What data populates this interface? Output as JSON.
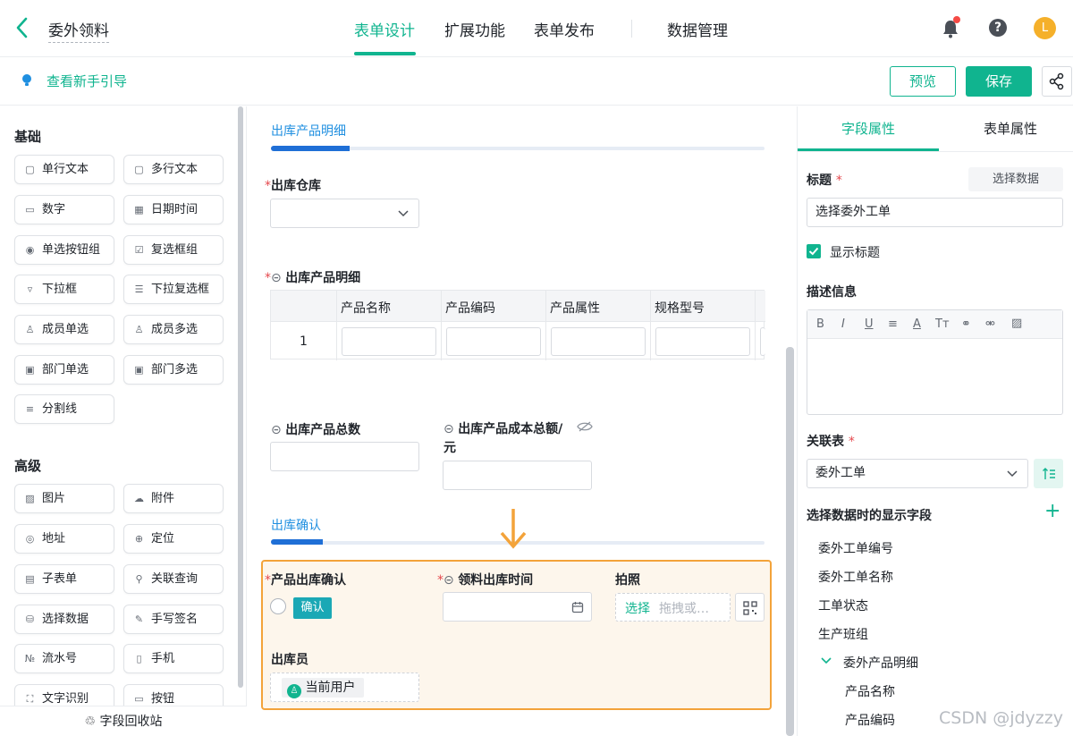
{
  "header": {
    "app_name": "委外领料",
    "tabs": [
      "表单设计",
      "扩展功能",
      "表单发布",
      "数据管理"
    ],
    "active_tab": 0,
    "avatar_letter": "L"
  },
  "toolbar": {
    "guide_link": "查看新手引导",
    "preview_label": "预览",
    "save_label": "保存"
  },
  "left_panel": {
    "basic_title": "基础",
    "basic_controls": [
      "单行文本",
      "多行文本",
      "数字",
      "日期时间",
      "单选按钮组",
      "复选框组",
      "下拉框",
      "下拉复选框",
      "成员单选",
      "成员多选",
      "部门单选",
      "部门多选",
      "分割线"
    ],
    "advanced_title": "高级",
    "advanced_controls": [
      "图片",
      "附件",
      "地址",
      "定位",
      "子表单",
      "关联查询",
      "选择数据",
      "手写签名",
      "流水号",
      "手机",
      "文字识别",
      "按钮"
    ],
    "recycle_label": "字段回收站"
  },
  "canvas": {
    "section1_title": "出库产品明细",
    "warehouse_label": "出库仓库",
    "detail_table_label": "出库产品明细",
    "table_headers": [
      "产品名称",
      "产品编码",
      "产品属性",
      "规格型号"
    ],
    "row_index": "1",
    "total_qty_label": "出库产品总数",
    "total_cost_label": "出库产品成本总额/元",
    "section2_title": "出库确认",
    "confirm_label": "产品出库确认",
    "confirm_tag": "确认",
    "time_label": "领料出库时间",
    "photo_label": "拍照",
    "photo_select": "选择",
    "photo_drag": "拖拽或…",
    "operator_label": "出库员",
    "current_user": "当前用户"
  },
  "right_panel": {
    "tabs": [
      "字段属性",
      "表单属性"
    ],
    "title_label": "标题",
    "select_data_btn": "选择数据",
    "title_value": "选择委外工单",
    "show_title_label": "显示标题",
    "show_title_checked": true,
    "desc_label": "描述信息",
    "rte_buttons": [
      "B",
      "I",
      "U",
      "≡",
      "A",
      "Tт"
    ],
    "related_table_label": "关联表",
    "related_table_value": "委外工单",
    "display_fields_label": "选择数据时的显示字段",
    "display_fields": [
      "委外工单编号",
      "委外工单名称",
      "工单状态",
      "生产班组"
    ],
    "group_field": "委外产品明细",
    "sub_fields": [
      "产品名称",
      "产品编码"
    ]
  },
  "watermark": "CSDN @jdyzzy",
  "colors": {
    "accent": "#10b48f",
    "blue": "#1f6fd6",
    "orange": "#f3a33a",
    "required": "#e5484d"
  }
}
